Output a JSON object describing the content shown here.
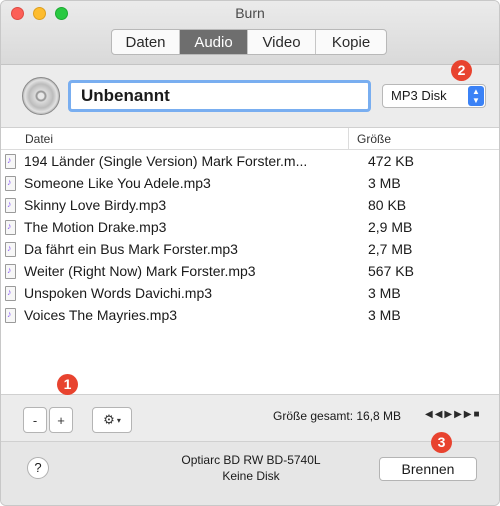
{
  "window": {
    "title": "Burn"
  },
  "tabs": [
    {
      "label": "Daten",
      "active": false
    },
    {
      "label": "Audio",
      "active": true
    },
    {
      "label": "Video",
      "active": false
    },
    {
      "label": "Kopie",
      "active": false
    }
  ],
  "disc": {
    "name_value": "Unbenannt",
    "format": "MP3 Disk"
  },
  "table": {
    "col_name": "Datei",
    "col_size": "Größe",
    "rows": [
      {
        "name": "194 Länder (Single Version) Mark Forster.m...",
        "size": "472 KB"
      },
      {
        "name": "Someone Like You Adele.mp3",
        "size": "3 MB"
      },
      {
        "name": "Skinny Love Birdy.mp3",
        "size": "80 KB"
      },
      {
        "name": "The Motion Drake.mp3",
        "size": "2,9 MB"
      },
      {
        "name": "Da fährt ein Bus Mark Forster.mp3",
        "size": "2,7 MB"
      },
      {
        "name": "Weiter (Right Now) Mark Forster.mp3",
        "size": "567 KB"
      },
      {
        "name": "Unspoken Words Davichi.mp3",
        "size": "3 MB"
      },
      {
        "name": "Voices The Mayries.mp3",
        "size": "3 MB"
      }
    ]
  },
  "toolbar": {
    "minus": "-",
    "plus": "+",
    "total": "Größe gesamt: 16,8 MB"
  },
  "footer": {
    "help": "?",
    "drive_name": "Optiarc BD RW BD-5740L",
    "drive_status": "Keine Disk",
    "burn_label": "Brennen"
  },
  "annotations": [
    "1",
    "2",
    "3"
  ],
  "colors": {
    "accent": "#3b82f6",
    "annotation": "#e8432f",
    "focus_ring": "#79aef0"
  }
}
